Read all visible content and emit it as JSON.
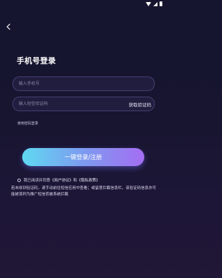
{
  "status_bar": {
    "icons": [
      "wifi-icon",
      "cellular-signal-icon",
      "battery-icon"
    ]
  },
  "header": {
    "back_icon": "chevron-left-icon"
  },
  "page": {
    "title": "手机号登录"
  },
  "phone_input": {
    "placeholder": "输入手机号",
    "value": ""
  },
  "code_input": {
    "placeholder": "输入短信验证码",
    "value": ""
  },
  "get_code_label": "获取验证码",
  "password_login_label": "使用密码登录",
  "cta_label": "一键登录/注册",
  "agreement": {
    "prefix": "我已阅读并同意",
    "user_agreement": "《用户协议》",
    "and": "和",
    "privacy_policy": "《隐私政策》"
  },
  "notice": "若未收到验证码，请手动前往短信应用中查看；或留意拦截信息栏，该验证码信息亦可能被误判为推广短信而被系统拦截",
  "colors": {
    "background_top": "#15152f",
    "background_bottom": "#211737",
    "cta_gradient_start": "#5fd9f1",
    "cta_gradient_end": "#a56df2"
  }
}
